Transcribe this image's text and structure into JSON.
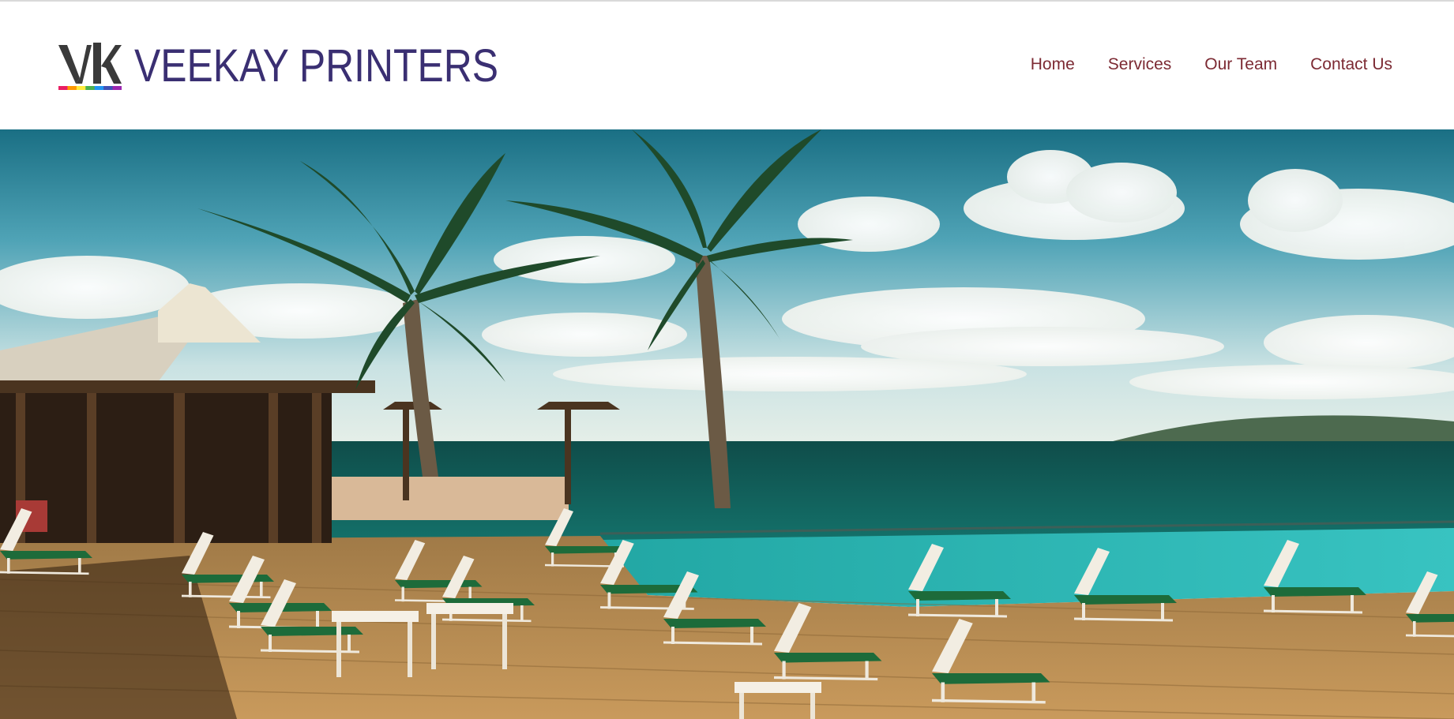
{
  "brand": {
    "name": "VEEKAY PRINTERS",
    "mark_colors": [
      "#e91e63",
      "#ff9800",
      "#ffeb3b",
      "#4caf50",
      "#2196f3",
      "#3f51b5",
      "#9c27b0"
    ],
    "text_color": "#3a2f72",
    "mark_color": "#3a3a3a"
  },
  "nav": {
    "items": [
      {
        "label": "Home"
      },
      {
        "label": "Services"
      },
      {
        "label": "Our Team"
      },
      {
        "label": "Contact Us"
      }
    ],
    "color": "#7c2a33"
  },
  "hero": {
    "image": "resort-pool-deck-with-palm-trees-and-sea"
  }
}
